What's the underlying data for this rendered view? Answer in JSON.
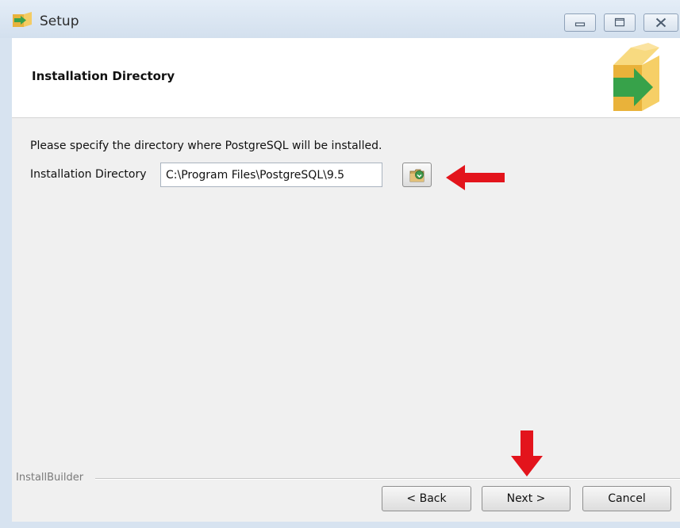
{
  "window": {
    "title": "Setup"
  },
  "header": {
    "title": "Installation Directory"
  },
  "main": {
    "instruction": "Please specify the directory where PostgreSQL will be installed.",
    "directory_label": "Installation Directory",
    "directory_value": "C:\\Program Files\\PostgreSQL\\9.5"
  },
  "footer": {
    "brand": "InstallBuilder",
    "back_label": "< Back",
    "next_label": "Next >",
    "cancel_label": "Cancel"
  },
  "icons": {
    "app": "installer-box-icon",
    "logo": "installer-box-logo",
    "browse": "folder-browse-icon",
    "annotation_arrows": [
      "red-arrow-left",
      "red-arrow-down"
    ]
  },
  "colors": {
    "annotation_red": "#e3141c",
    "box_yellow": "#f0c14b",
    "arrow_green": "#3aa24b"
  }
}
